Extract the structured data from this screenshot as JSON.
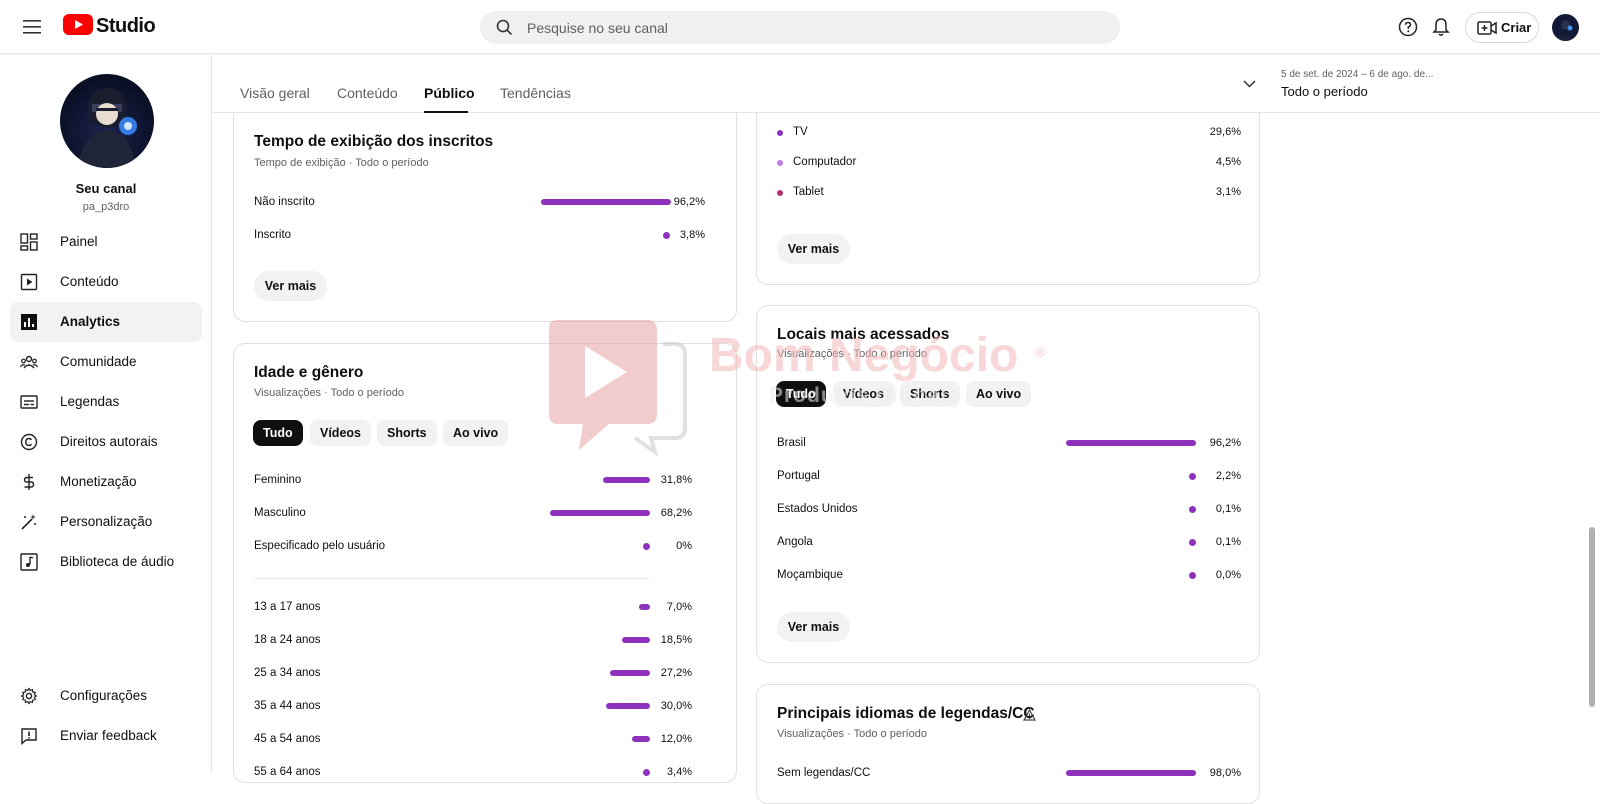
{
  "header": {
    "logo_text": "Studio",
    "search_placeholder": "Pesquise no seu canal",
    "create_label": "Criar"
  },
  "sidebar": {
    "channel_name": "Seu canal",
    "channel_handle": "pa_p3dro",
    "items": [
      {
        "label": "Painel",
        "icon": "dashboard-icon"
      },
      {
        "label": "Conteúdo",
        "icon": "content-icon"
      },
      {
        "label": "Analytics",
        "icon": "analytics-icon",
        "active": true
      },
      {
        "label": "Comunidade",
        "icon": "community-icon"
      },
      {
        "label": "Legendas",
        "icon": "subtitles-icon"
      },
      {
        "label": "Direitos autorais",
        "icon": "copyright-icon"
      },
      {
        "label": "Monetização",
        "icon": "dollar-icon"
      },
      {
        "label": "Personalização",
        "icon": "magic-wand-icon"
      },
      {
        "label": "Biblioteca de áudio",
        "icon": "audio-library-icon"
      }
    ],
    "footer_items": [
      {
        "label": "Configurações",
        "icon": "gear-icon"
      },
      {
        "label": "Enviar feedback",
        "icon": "feedback-icon"
      }
    ]
  },
  "tabs": {
    "items": [
      "Visão geral",
      "Conteúdo",
      "Público",
      "Tendências"
    ],
    "active": "Público",
    "date_range": "5 de set. de 2024 – 6 de ago. de...",
    "period": "Todo o período"
  },
  "subscribers_card": {
    "title": "Tempo de exibição dos inscritos",
    "subtitle": "Tempo de exibição · Todo o período",
    "rows": [
      {
        "label": "Não inscrito",
        "value": "96,2%",
        "pct": 96.2
      },
      {
        "label": "Inscrito",
        "value": "3,8%",
        "pct": 3.8
      }
    ],
    "more": "Ver mais"
  },
  "age_gender_card": {
    "title": "Idade e gênero",
    "subtitle": "Visualizações · Todo o período",
    "chips": [
      "Tudo",
      "Vídeos",
      "Shorts",
      "Ao vivo"
    ],
    "gender_rows": [
      {
        "label": "Feminino",
        "value": "31,8%",
        "pct": 31.8
      },
      {
        "label": "Masculino",
        "value": "68,2%",
        "pct": 68.2
      },
      {
        "label": "Especificado pelo usuário",
        "value": "0%",
        "pct": 0
      }
    ],
    "age_rows": [
      {
        "label": "13 a 17 anos",
        "value": "7,0%",
        "pct": 7.0
      },
      {
        "label": "18 a 24 anos",
        "value": "18,5%",
        "pct": 18.5
      },
      {
        "label": "25 a 34 anos",
        "value": "27,2%",
        "pct": 27.2
      },
      {
        "label": "35 a 44 anos",
        "value": "30,0%",
        "pct": 30.0
      },
      {
        "label": "45 a 54 anos",
        "value": "12,0%",
        "pct": 12.0
      },
      {
        "label": "55 a 64 anos",
        "value": "3,4%",
        "pct": 3.4
      }
    ]
  },
  "devices_card": {
    "rows": [
      {
        "label": "TV",
        "value": "29,6%",
        "color": "#8e32be"
      },
      {
        "label": "Computador",
        "value": "4,5%",
        "color": "#c27ee0"
      },
      {
        "label": "Tablet",
        "value": "3,1%",
        "color": "#b5306c"
      }
    ],
    "more": "Ver mais"
  },
  "locations_card": {
    "title": "Locais mais acessados",
    "subtitle": "Visualizações · Todo o período",
    "chips": [
      "Tudo",
      "Vídeos",
      "Shorts",
      "Ao vivo"
    ],
    "rows": [
      {
        "label": "Brasil",
        "value": "96,2%",
        "pct": 96.2
      },
      {
        "label": "Portugal",
        "value": "2,2%",
        "pct": 2.2
      },
      {
        "label": "Estados Unidos",
        "value": "0,1%",
        "pct": 0.1
      },
      {
        "label": "Angola",
        "value": "0,1%",
        "pct": 0.1
      },
      {
        "label": "Moçambique",
        "value": "0,0%",
        "pct": 0.0
      }
    ],
    "more": "Ver mais"
  },
  "languages_card": {
    "title": "Principais idiomas de legendas/CC",
    "subtitle": "Visualizações · Todo o período",
    "rows": [
      {
        "label": "Sem legendas/CC",
        "value": "98,0%",
        "pct": 98.0
      }
    ]
  },
  "watermark": {
    "line1": "Bom Negócio",
    "line2": "Produtos Digitais",
    "mark": "®"
  }
}
